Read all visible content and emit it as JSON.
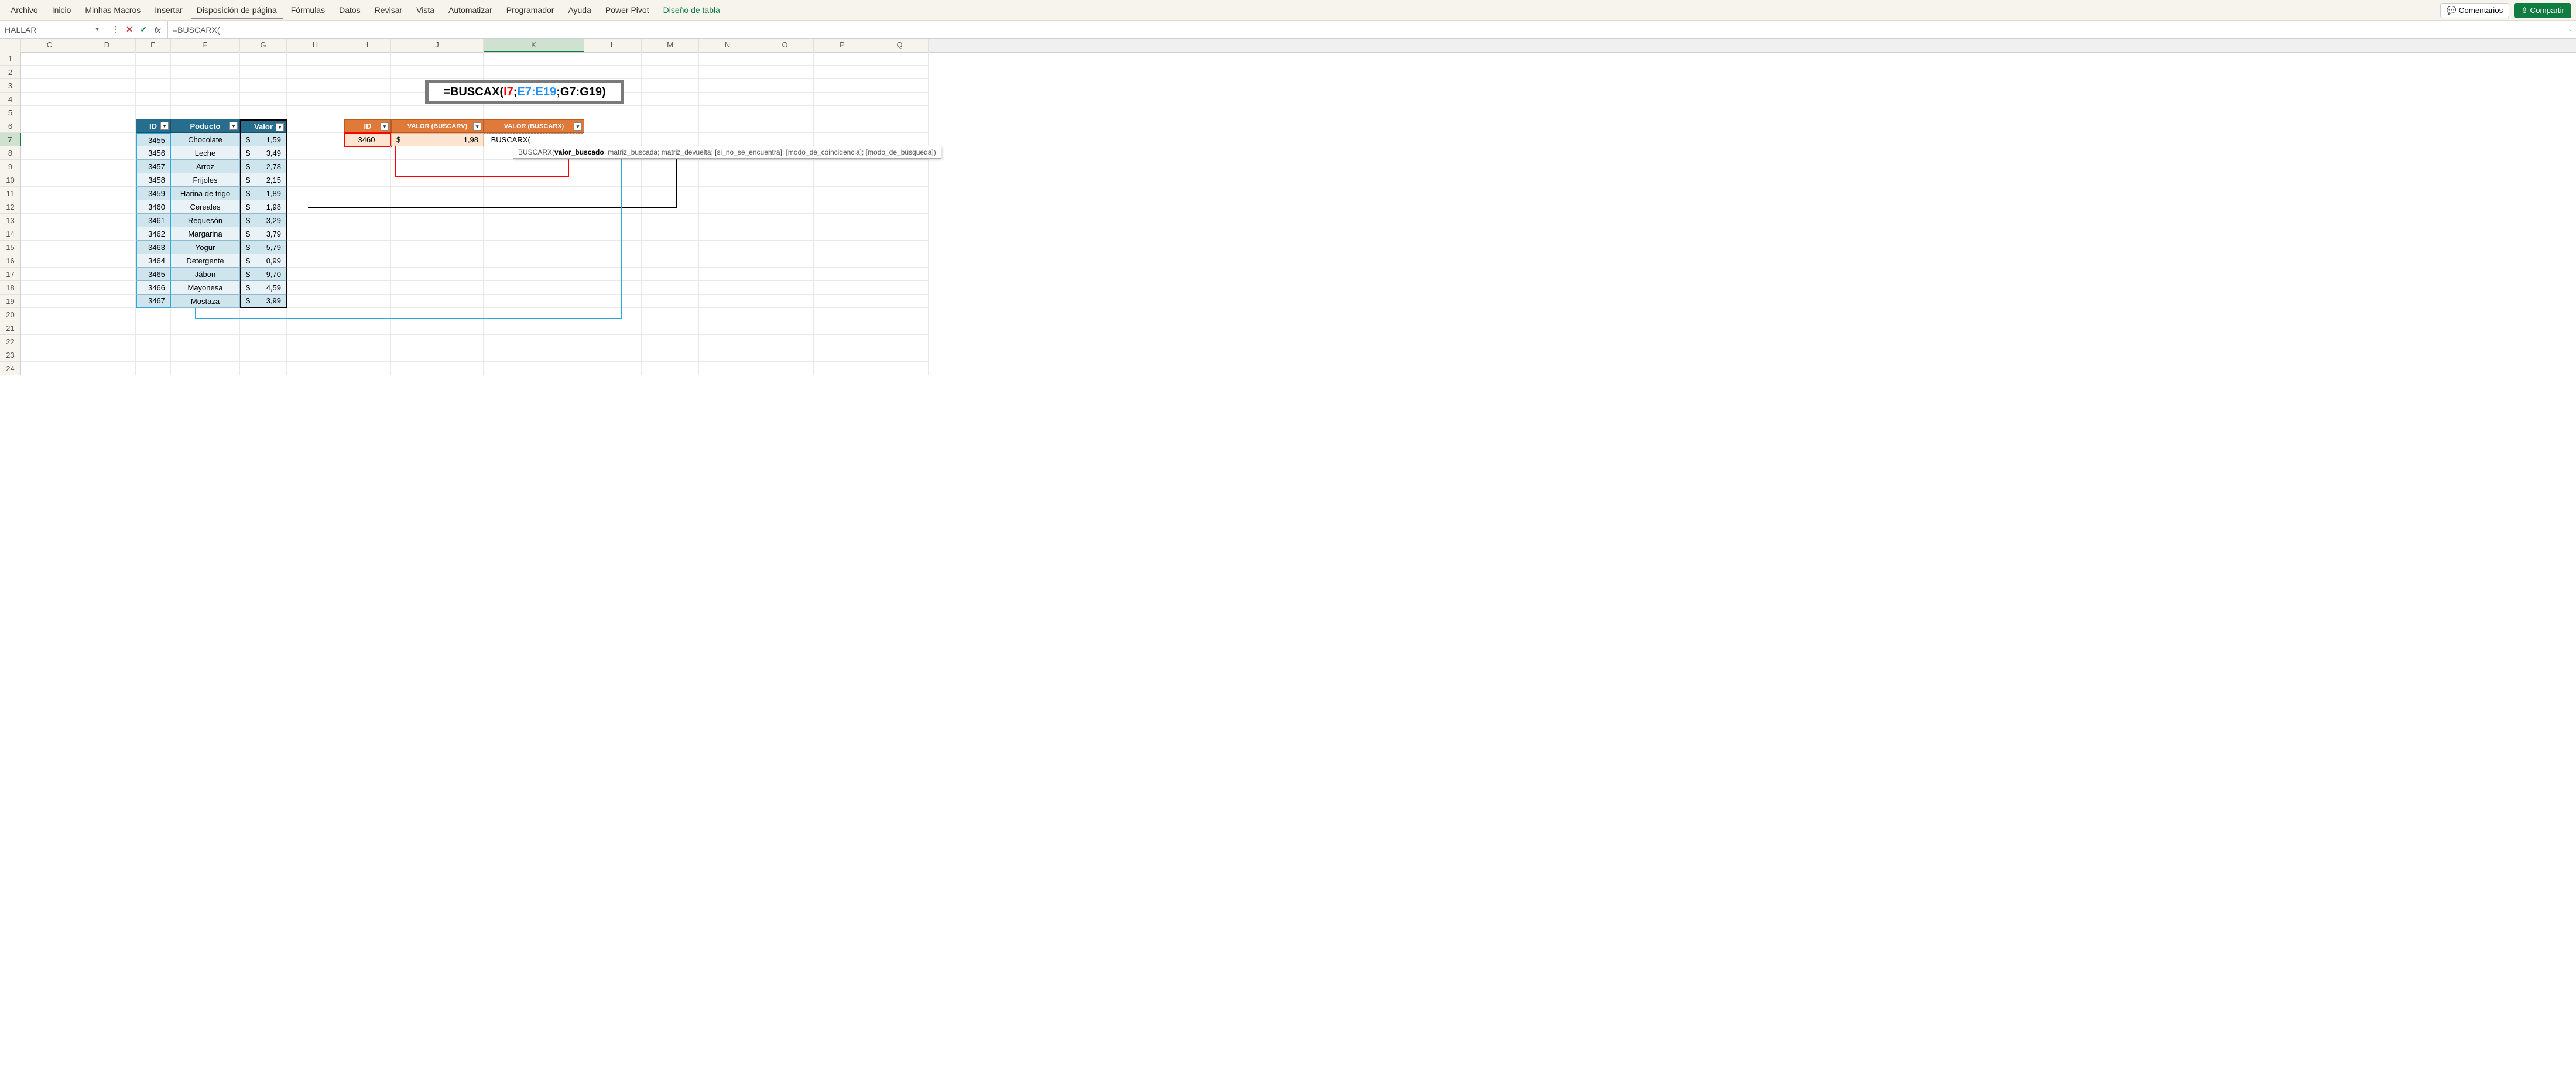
{
  "ribbon": {
    "tabs": [
      "Archivo",
      "Inicio",
      "Minhas Macros",
      "Insertar",
      "Disposición de página",
      "Fórmulas",
      "Datos",
      "Revisar",
      "Vista",
      "Automatizar",
      "Programador",
      "Ayuda",
      "Power Pivot",
      "Diseño de tabla"
    ],
    "active_index": 13,
    "underline_index": 4,
    "comments": "Comentarios",
    "share": "Compartir"
  },
  "name_box": "HALLAR",
  "formula_input": "=BUSCARX(",
  "columns": [
    "",
    "C",
    "D",
    "E",
    "F",
    "G",
    "H",
    "I",
    "J",
    "K",
    "L",
    "M",
    "N",
    "O",
    "P",
    "Q"
  ],
  "rows": [
    "1",
    "2",
    "3",
    "4",
    "5",
    "6",
    "7",
    "8",
    "9",
    "10",
    "11",
    "12",
    "13",
    "14",
    "15",
    "16",
    "17",
    "18",
    "19",
    "20",
    "21",
    "22",
    "23",
    "24"
  ],
  "selected_col_index": 9,
  "selected_row_index": 6,
  "table1": {
    "headers": [
      "ID",
      "Poducto",
      "Valor"
    ],
    "rows": [
      {
        "id": "3455",
        "prod": "Chocolate",
        "cur": "$",
        "val": "1,59"
      },
      {
        "id": "3456",
        "prod": "Leche",
        "cur": "$",
        "val": "3,49"
      },
      {
        "id": "3457",
        "prod": "Arroz",
        "cur": "$",
        "val": "2,78"
      },
      {
        "id": "3458",
        "prod": "Frijoles",
        "cur": "$",
        "val": "2,15"
      },
      {
        "id": "3459",
        "prod": "Harina de trigo",
        "cur": "$",
        "val": "1,89"
      },
      {
        "id": "3460",
        "prod": "Cereales",
        "cur": "$",
        "val": "1,98"
      },
      {
        "id": "3461",
        "prod": "Requesón",
        "cur": "$",
        "val": "3,29"
      },
      {
        "id": "3462",
        "prod": "Margarina",
        "cur": "$",
        "val": "3,79"
      },
      {
        "id": "3463",
        "prod": "Yogur",
        "cur": "$",
        "val": "5,79"
      },
      {
        "id": "3464",
        "prod": "Detergente",
        "cur": "$",
        "val": "0,99"
      },
      {
        "id": "3465",
        "prod": "Jábon",
        "cur": "$",
        "val": "9,70"
      },
      {
        "id": "3466",
        "prod": "Mayonesa",
        "cur": "$",
        "val": "4,59"
      },
      {
        "id": "3467",
        "prod": "Mostaza",
        "cur": "$",
        "val": "3,99"
      }
    ]
  },
  "table2": {
    "headers": [
      "ID",
      "VALOR (BUSCARV)",
      "VALOR (BUSCARX)"
    ],
    "id_val": "3460",
    "cur": "$",
    "buscarv_val": "1,98",
    "buscarx_edit": "=BUSCARX("
  },
  "formula_box": {
    "prefix": "=BUSCAX(",
    "arg1": "I7",
    "sep1": ";",
    "arg2": "E7:E19",
    "sep2": ";",
    "arg3": "G7:G19",
    "suffix": ")"
  },
  "tooltip": {
    "func": "BUSCARX(",
    "bold": "valor_buscado",
    "rest": "; matriz_buscada; matriz_devuelta; [si_no_se_encuentra]; [modo_de_coincidencia]; [modo_de_búsqueda])"
  }
}
